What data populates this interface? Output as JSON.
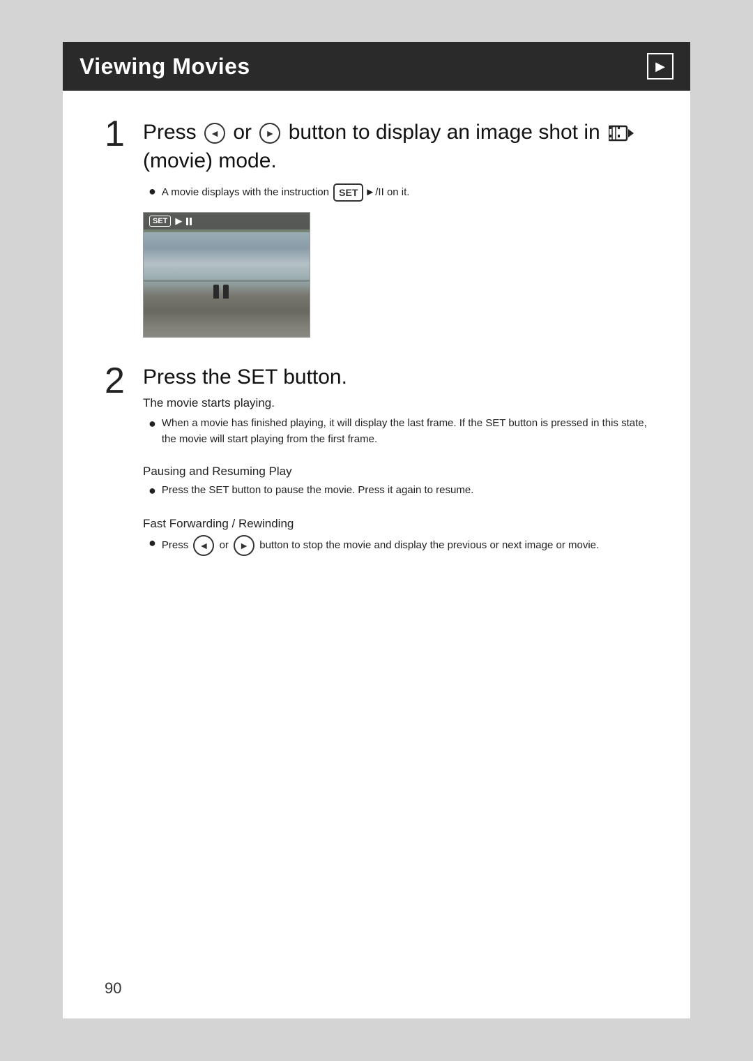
{
  "header": {
    "title": "Viewing Movies",
    "playback_icon": "▶"
  },
  "step1": {
    "number": "1",
    "text_before": "Press",
    "left_btn": "◄",
    "or_text": "or",
    "right_btn": "►",
    "text_after": "button to display an image shot in",
    "mode_label": "(movie) mode.",
    "bullet": "A movie displays with the instruction",
    "set_label": "SET",
    "play_pause": "►/II",
    "bullet_suffix": "on it."
  },
  "step2": {
    "number": "2",
    "main_text": "Press the SET button.",
    "movie_starts": "The movie starts playing.",
    "bullet1": "When a movie has finished playing, it will display the last frame. If the SET button is pressed in this state, the movie will start playing from the first frame.",
    "pausing_heading": "Pausing and Resuming Play",
    "pausing_bullet": "Press the SET button to pause the movie. Press it again to resume.",
    "fast_forward_heading": "Fast Forwarding / Rewinding",
    "fast_forward_before": "Press",
    "left_btn": "◄",
    "or_text": "or",
    "right_btn": "►",
    "fast_forward_after": "button to stop the movie and display the previous or next image or movie."
  },
  "page_number": "90"
}
